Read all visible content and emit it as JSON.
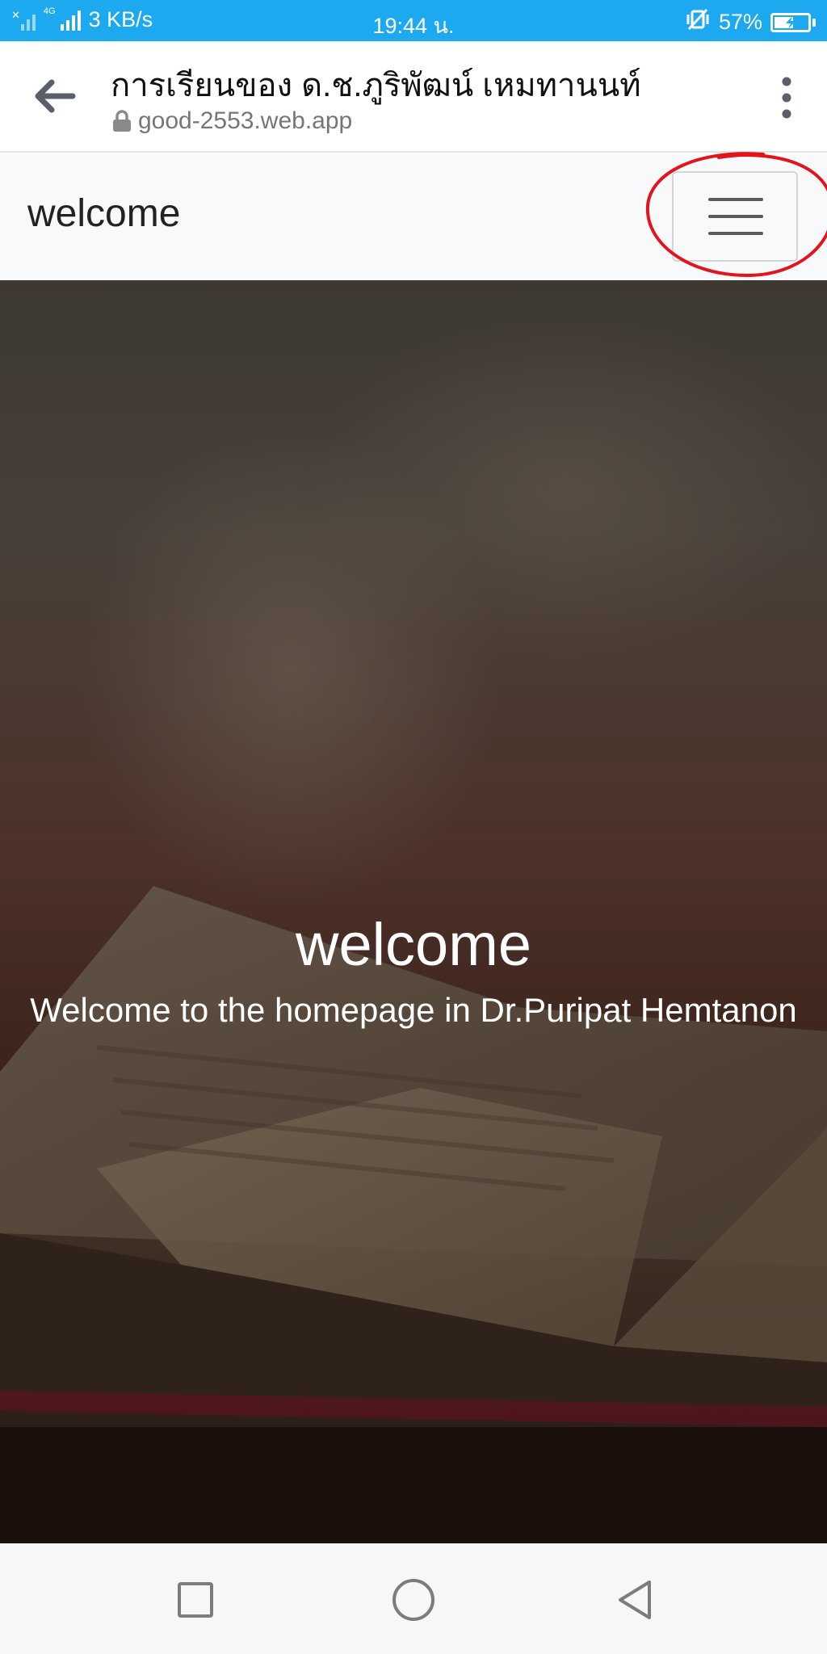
{
  "status_bar": {
    "network_speed": "3 KB/s",
    "network_type": "4G",
    "time": "19:44 น.",
    "battery_percent": "57%",
    "battery_level": 0.57
  },
  "browser": {
    "page_title": "การเรียนของ ด.ช.ภูริพัฒน์ เหมทานนท์",
    "url": "good-2553.web.app"
  },
  "site_nav": {
    "brand": "welcome"
  },
  "hero": {
    "title": "welcome",
    "subtitle": "Welcome to the homepage in Dr.Puripat Hemtanon"
  },
  "colors": {
    "status_bar": "#1da9ef",
    "navbar_bg": "#f8f9fa",
    "annotation_circle": "#e3141c"
  },
  "icons": {
    "back": "arrow-left-icon",
    "lock": "lock-icon",
    "more": "more-vertical-icon",
    "menu": "hamburger-menu-icon",
    "recent_apps": "square-icon",
    "home": "circle-icon",
    "system_back": "triangle-back-icon"
  }
}
